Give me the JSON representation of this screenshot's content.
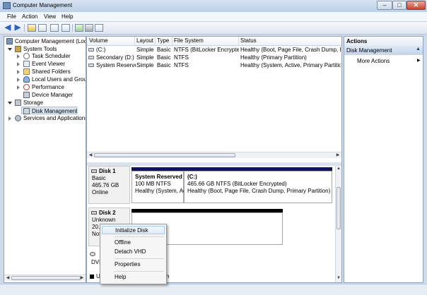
{
  "window": {
    "title": "Computer Management"
  },
  "menu": [
    "File",
    "Action",
    "View",
    "Help"
  ],
  "tree": {
    "root": "Computer Management (Local",
    "system_tools": "System Tools",
    "system_tools_children": [
      "Task Scheduler",
      "Event Viewer",
      "Shared Folders",
      "Local Users and Groups",
      "Performance",
      "Device Manager"
    ],
    "storage": "Storage",
    "disk_management": "Disk Management",
    "services": "Services and Applications"
  },
  "volume_list": {
    "columns": [
      "Volume",
      "Layout",
      "Type",
      "File System",
      "Status"
    ],
    "rows": [
      {
        "volume": "(C:)",
        "layout": "Simple",
        "type": "Basic",
        "fs": "NTFS (BitLocker Encrypted)",
        "status": "Healthy (Boot, Page File, Crash Dump, Prima"
      },
      {
        "volume": "Secondary (D:)",
        "layout": "Simple",
        "type": "Basic",
        "fs": "NTFS",
        "status": "Healthy (Primary Partition)"
      },
      {
        "volume": "System Reserved",
        "layout": "Simple",
        "type": "Basic",
        "fs": "NTFS",
        "status": "Healthy (System, Active, Primary Partition)"
      }
    ]
  },
  "disks": {
    "disk1": {
      "name": "Disk 1",
      "type": "Basic",
      "size": "465.76 GB",
      "state": "Online",
      "part1": {
        "name": "System Reserved",
        "size": "100 MB NTFS",
        "status": "Healthy (System, Ac"
      },
      "part2": {
        "name": "(C:)",
        "size": "465.66 GB NTFS (BitLocker Encrypted)",
        "status": "Healthy (Boot, Page File, Crash Dump, Primary Partition)"
      }
    },
    "disk2": {
      "name": "Disk 2",
      "type": "Unknown",
      "size_partial": "20.0",
      "state_partial": "Not"
    },
    "disk3": {
      "label_partial": "DVD"
    },
    "legend_partial_left": "U",
    "legend_partial_right": "n"
  },
  "actions": {
    "header": "Actions",
    "section": "Disk Management",
    "more": "More Actions",
    "more_arrow": "▶"
  },
  "context_menu": {
    "items": [
      "Initialize Disk",
      "Offline",
      "Detach VHD",
      "Properties",
      "Help"
    ]
  }
}
